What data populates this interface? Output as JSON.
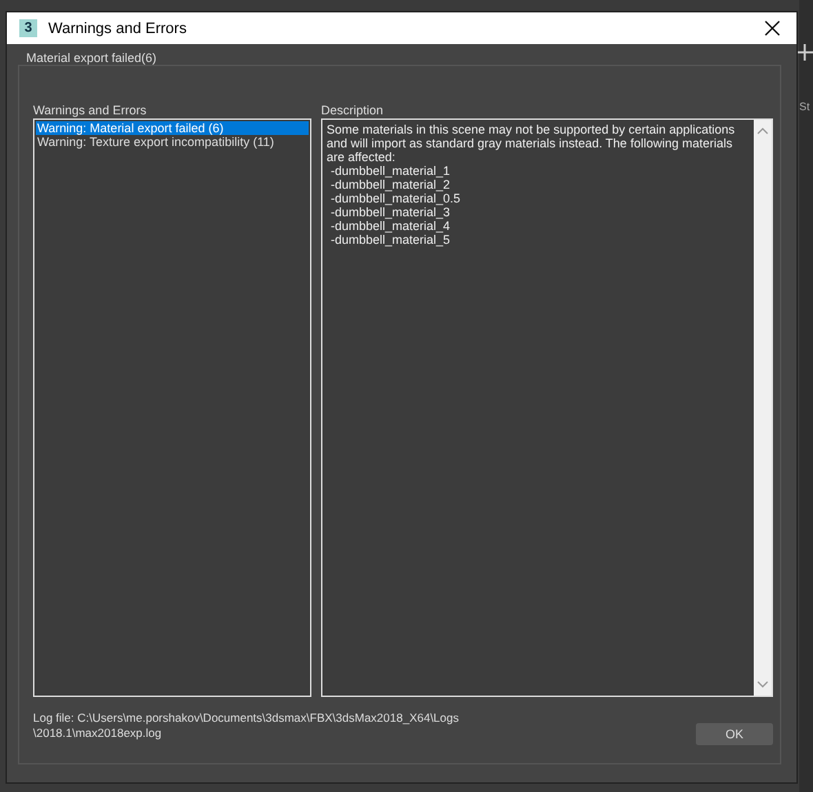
{
  "background": {
    "label": "St"
  },
  "window": {
    "title": "Warnings and Errors",
    "app_icon": "3"
  },
  "group": {
    "title": "Material export failed(6)"
  },
  "warnings": {
    "label": "Warnings and Errors",
    "items": [
      {
        "text": "Warning: Material export failed (6)",
        "selected": true
      },
      {
        "text": "Warning: Texture export incompatibility (11)",
        "selected": false
      }
    ]
  },
  "description": {
    "label": "Description",
    "text": "Some materials in this scene may not be supported by certain applications and will import as standard gray materials instead. The following materials are affected:",
    "materials": [
      "-dumbbell_material_1",
      "-dumbbell_material_2",
      "-dumbbell_material_0.5",
      "-dumbbell_material_3",
      "-dumbbell_material_4",
      "-dumbbell_material_5"
    ]
  },
  "log": {
    "lines": [
      "Log file: C:\\Users\\me.porshakov\\Documents\\3dsmax\\FBX\\3dsMax2018_X64\\Logs",
      "\\2018.1\\max2018exp.log"
    ]
  },
  "buttons": [
    "OK"
  ]
}
